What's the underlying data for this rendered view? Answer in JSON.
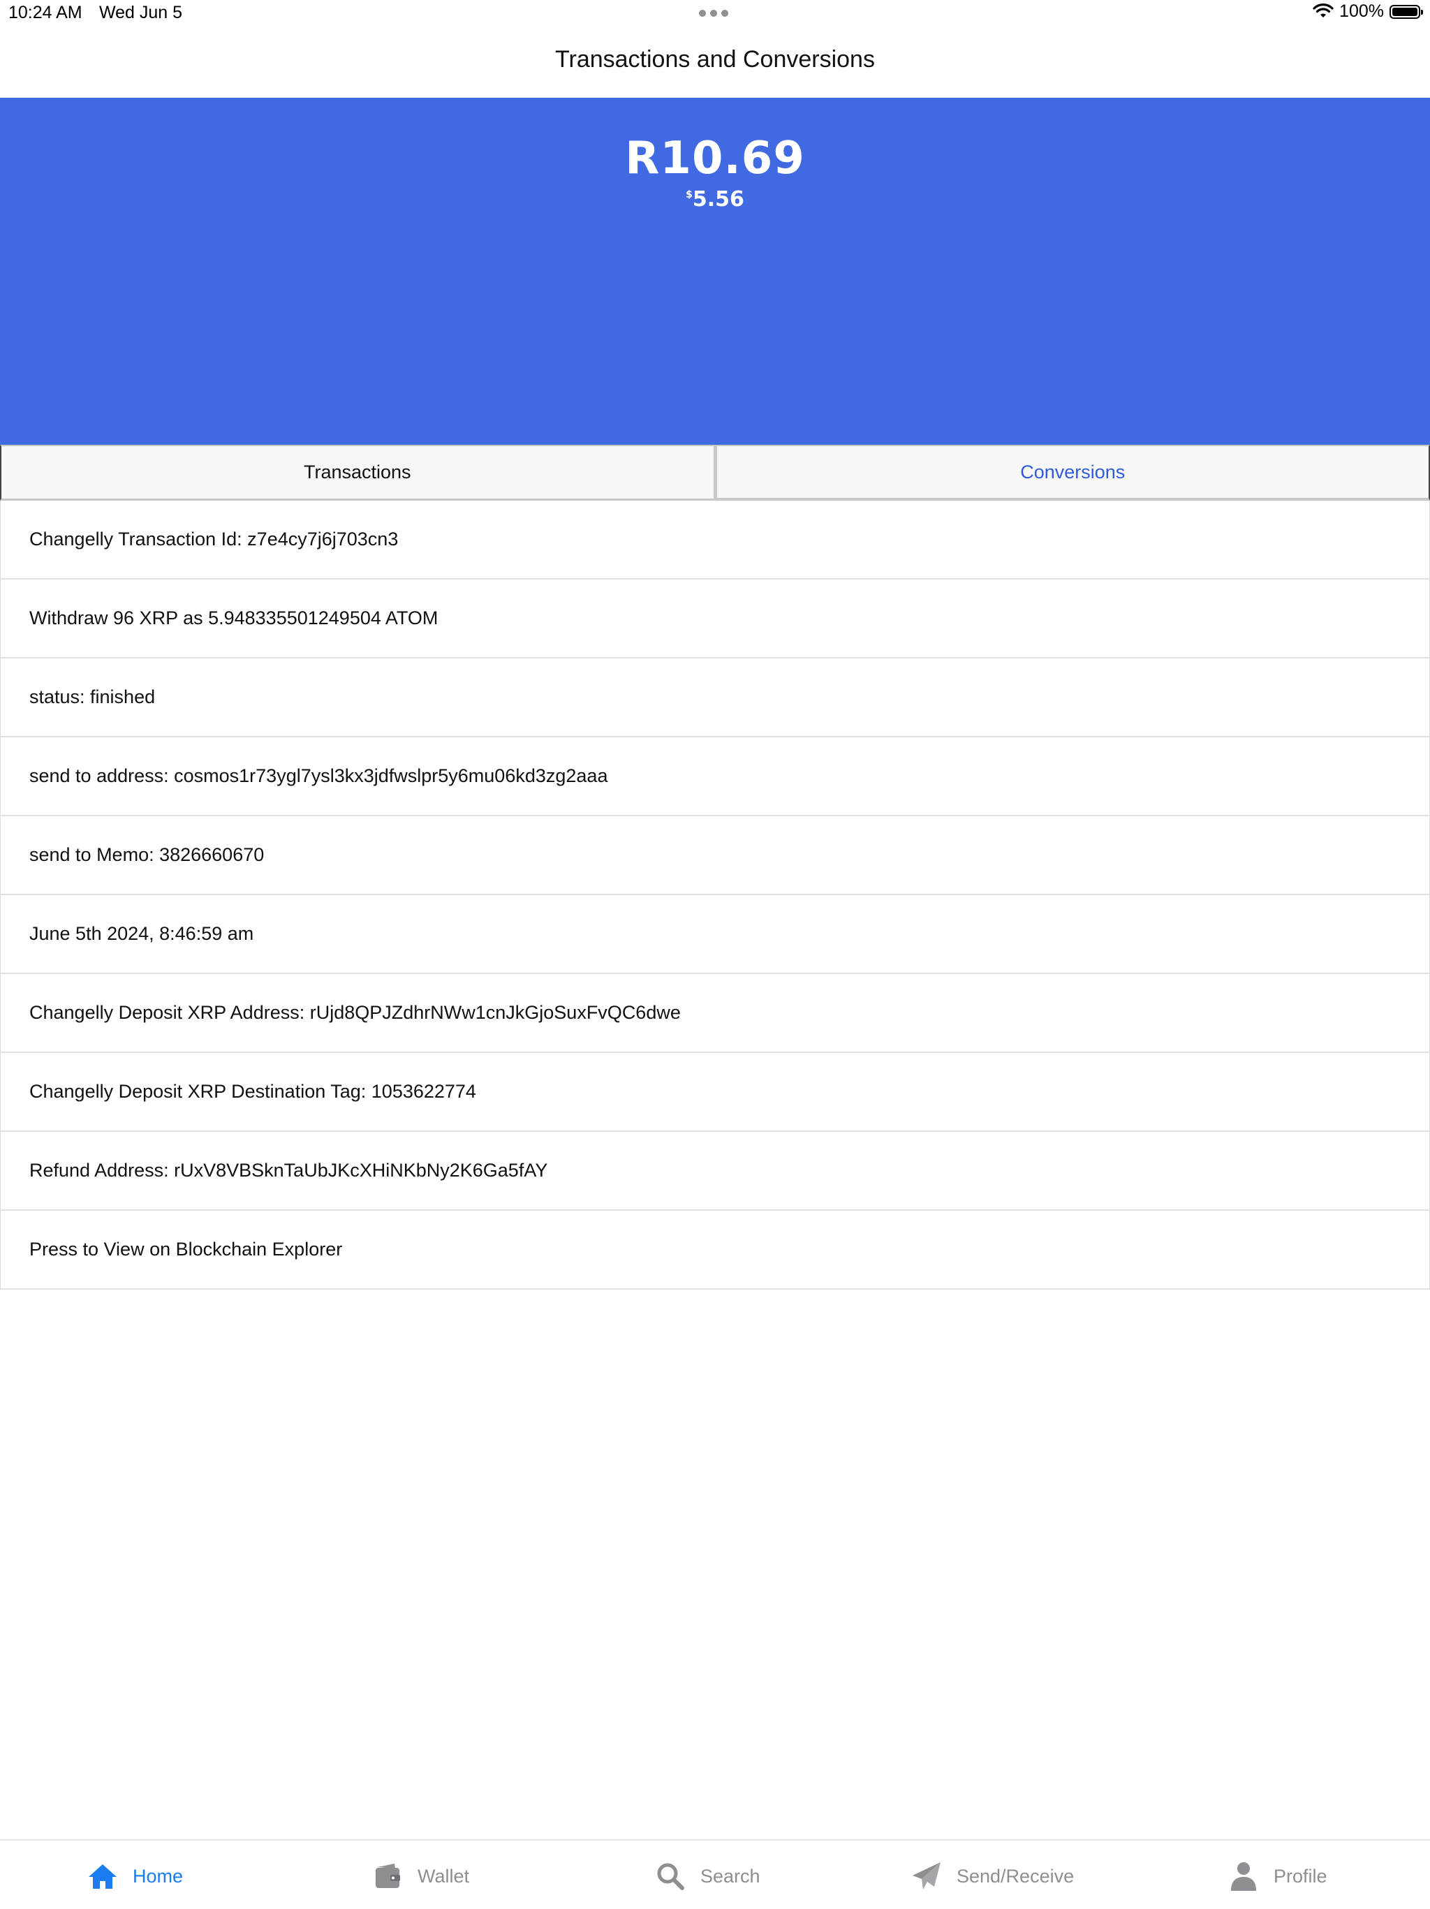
{
  "status_bar": {
    "time": "10:24 AM",
    "date": "Wed Jun 5",
    "battery_text": "100%"
  },
  "nav": {
    "title": "Transactions and Conversions"
  },
  "balance": {
    "primary": "R10.69",
    "secondary_symbol": "$",
    "secondary_amount": "5.56"
  },
  "tabs": [
    {
      "label": "Transactions"
    },
    {
      "label": "Conversions"
    }
  ],
  "details": [
    {
      "text": "Changelly Transaction Id: z7e4cy7j6j703cn3"
    },
    {
      "text": "Withdraw 96 XRP as 5.948335501249504 ATOM"
    },
    {
      "text": "status: finished"
    },
    {
      "text": "send to address: cosmos1r73ygl7ysl3kx3jdfwslpr5y6mu06kd3zg2aaa"
    },
    {
      "text": "send to Memo: 3826660670"
    },
    {
      "text": "June 5th 2024, 8:46:59 am"
    },
    {
      "text": "Changelly Deposit XRP Address: rUjd8QPJZdhrNWw1cnJkGjoSuxFvQC6dwe"
    },
    {
      "text": "Changelly Deposit XRP Destination Tag: 1053622774"
    },
    {
      "text": "Refund Address: rUxV8VBSknTaUbJKcXHiNKbNy2K6Ga5fAY"
    },
    {
      "text": "Press to View on Blockchain Explorer"
    }
  ],
  "tabbar": [
    {
      "label": "Home",
      "icon": "home-icon",
      "active": true
    },
    {
      "label": "Wallet",
      "icon": "wallet-icon",
      "active": false
    },
    {
      "label": "Search",
      "icon": "search-icon",
      "active": false
    },
    {
      "label": "Send/Receive",
      "icon": "paper-plane-icon",
      "active": false
    },
    {
      "label": "Profile",
      "icon": "person-icon",
      "active": false
    }
  ],
  "colors": {
    "hero_background": "#4169e1",
    "active_tab_text": "#2f5bd8",
    "tabbar_active": "#1a7cf0",
    "tabbar_inactive": "#8e8e93"
  }
}
